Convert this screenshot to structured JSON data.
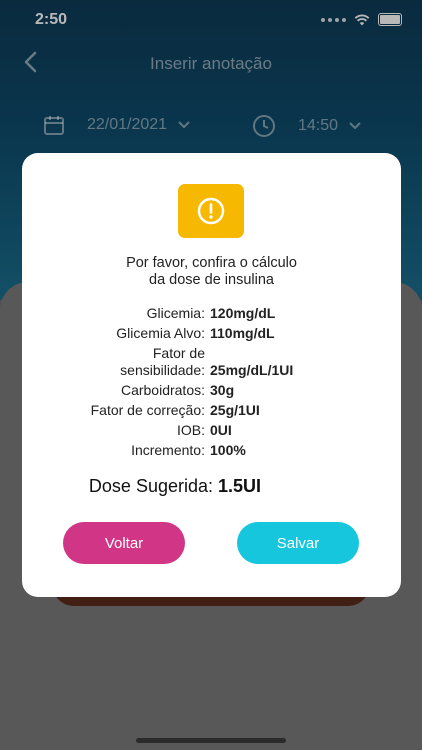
{
  "status_bar": {
    "time": "2:50"
  },
  "nav": {
    "title": "Inserir anotação"
  },
  "date_time": {
    "date": "22/01/2021",
    "time": "14:50"
  },
  "modal": {
    "prompt_line1": "Por favor, confira o cálculo",
    "prompt_line2": "da dose de insulina",
    "rows": [
      {
        "label": "Glicemia:",
        "value": "120mg/dL"
      },
      {
        "label": "Glicemia Alvo:",
        "value": "110mg/dL"
      },
      {
        "label_line1": "Fator de",
        "label_line2": "sensibilidade:",
        "value": "25mg/dL/1UI"
      },
      {
        "label": "Carboidratos:",
        "value": "30g"
      },
      {
        "label": "Fator de correção:",
        "value": "25g/1UI"
      },
      {
        "label": "IOB:",
        "value": "0UI"
      },
      {
        "label": "Incremento:",
        "value": "100%"
      }
    ],
    "dose": {
      "label": "Dose Sugerida:",
      "value": "1.5UI"
    },
    "buttons": {
      "back": "Voltar",
      "save": "Salvar"
    }
  },
  "colors": {
    "warning": "#f6b800",
    "back_button": "#d13585",
    "save_button": "#16c6dc"
  }
}
